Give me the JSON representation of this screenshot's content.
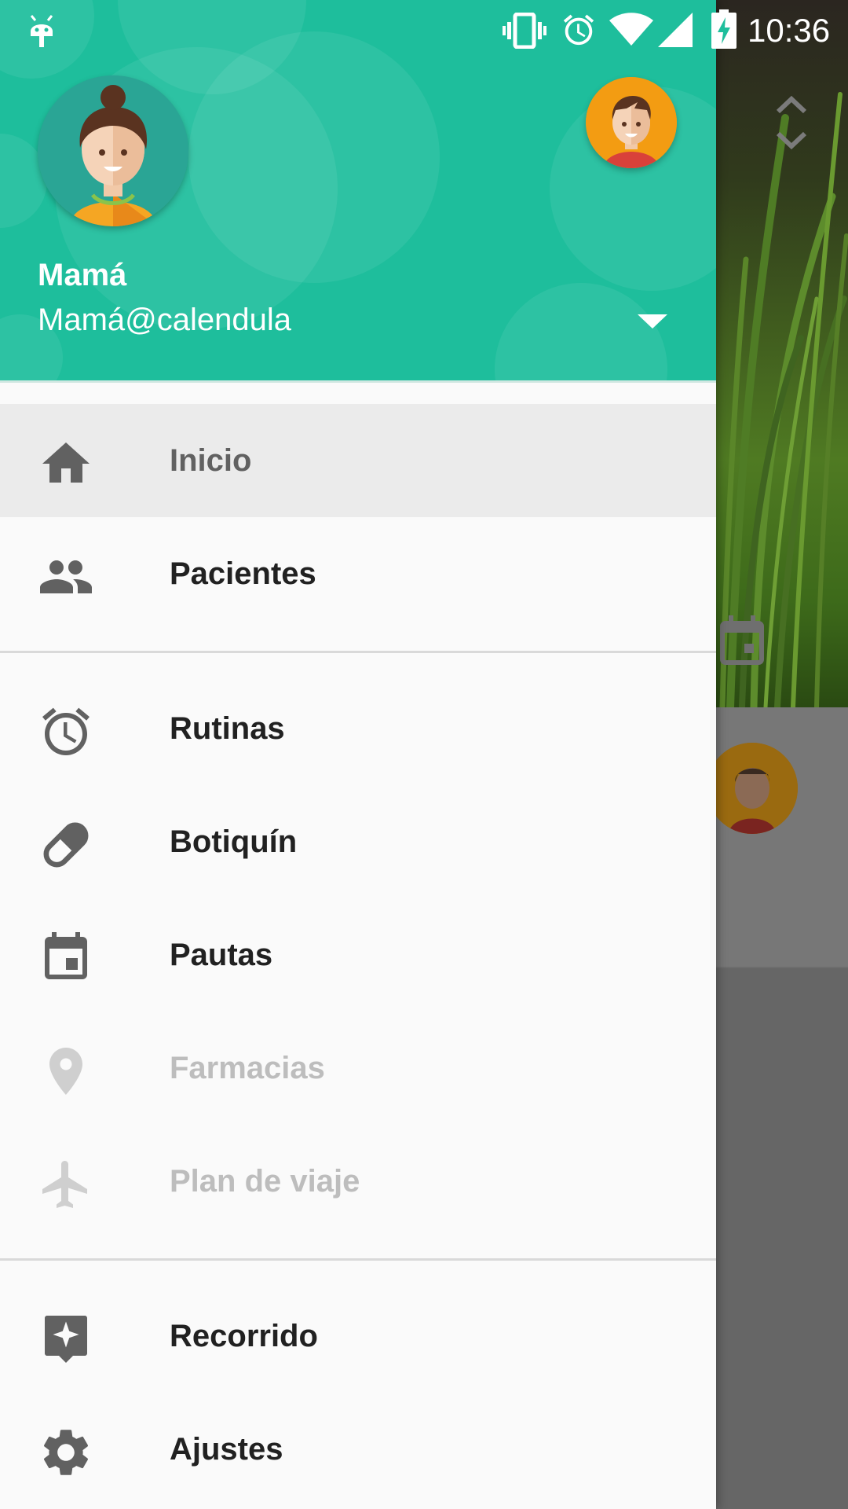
{
  "status_bar": {
    "time": "10:36",
    "icons": [
      "android-debug-icon",
      "vibrate-icon",
      "alarm-icon",
      "wifi-icon",
      "cell-signal-icon",
      "battery-charging-icon"
    ]
  },
  "drawer": {
    "header": {
      "account_name": "Mamá",
      "account_email": "Mamá@calendula",
      "accent_color": "#1ebe9c"
    },
    "sections": [
      {
        "items": [
          {
            "label": "Inicio",
            "icon": "home-icon",
            "state": "selected"
          },
          {
            "label": "Pacientes",
            "icon": "people-icon",
            "state": "enabled"
          }
        ]
      },
      {
        "items": [
          {
            "label": "Rutinas",
            "icon": "alarm-clock-icon",
            "state": "enabled"
          },
          {
            "label": "Botiquín",
            "icon": "pill-icon",
            "state": "enabled"
          },
          {
            "label": "Pautas",
            "icon": "calendar-icon",
            "state": "enabled"
          },
          {
            "label": "Farmacias",
            "icon": "location-pin-icon",
            "state": "disabled"
          },
          {
            "label": "Plan de viaje",
            "icon": "airplane-icon",
            "state": "disabled"
          }
        ]
      },
      {
        "items": [
          {
            "label": "Recorrido",
            "icon": "tour-icon",
            "state": "enabled"
          },
          {
            "label": "Ajustes",
            "icon": "settings-gear-icon",
            "state": "enabled"
          }
        ]
      }
    ]
  },
  "background_app": {
    "icons": [
      "sort-arrows-icon",
      "calendar-icon",
      "patient-avatar"
    ]
  }
}
